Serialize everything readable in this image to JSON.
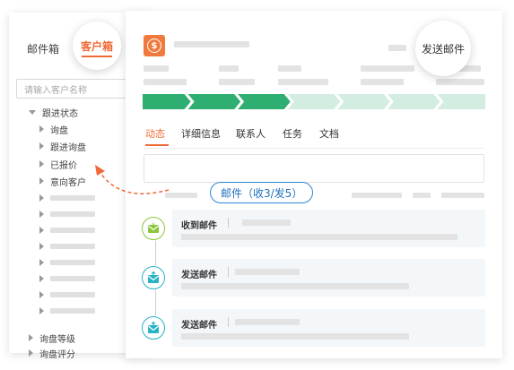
{
  "left_panel": {
    "mail_tab": "邮件箱",
    "customer_tab": "客户箱",
    "search_placeholder": "请输入客户名称",
    "tree": {
      "follow_status": "跟进状态",
      "inquiry": "询盘",
      "following_inquiry": "跟进询盘",
      "quoted": "已报价",
      "intent_customer": "意向客户",
      "inquiry_level": "询盘等级",
      "inquiry_score": "询盘评分"
    }
  },
  "main_panel": {
    "logo_icon": "dollar-icon",
    "send_mail_button": "发送邮件",
    "stepper": {
      "total_steps": 7,
      "completed_steps": 3,
      "completed_color": "#2fae72",
      "pending_color": "#d4ede1"
    },
    "tabs": [
      "动态",
      "详细信息",
      "联系人",
      "任务",
      "文档"
    ],
    "active_tab_index": 0,
    "mail_counter_pill": "邮件（收3/发5）",
    "timeline": [
      {
        "title": "收到邮件",
        "icon": "mail-received-icon",
        "color": "#8cc63e"
      },
      {
        "title": "发送邮件",
        "icon": "mail-sent-icon",
        "color": "#28b3c4"
      },
      {
        "title": "发送邮件",
        "icon": "mail-sent-icon",
        "color": "#28b3c4"
      }
    ]
  },
  "colors": {
    "accent_orange": "#ef6a36",
    "pill_blue": "#2f86d8"
  }
}
